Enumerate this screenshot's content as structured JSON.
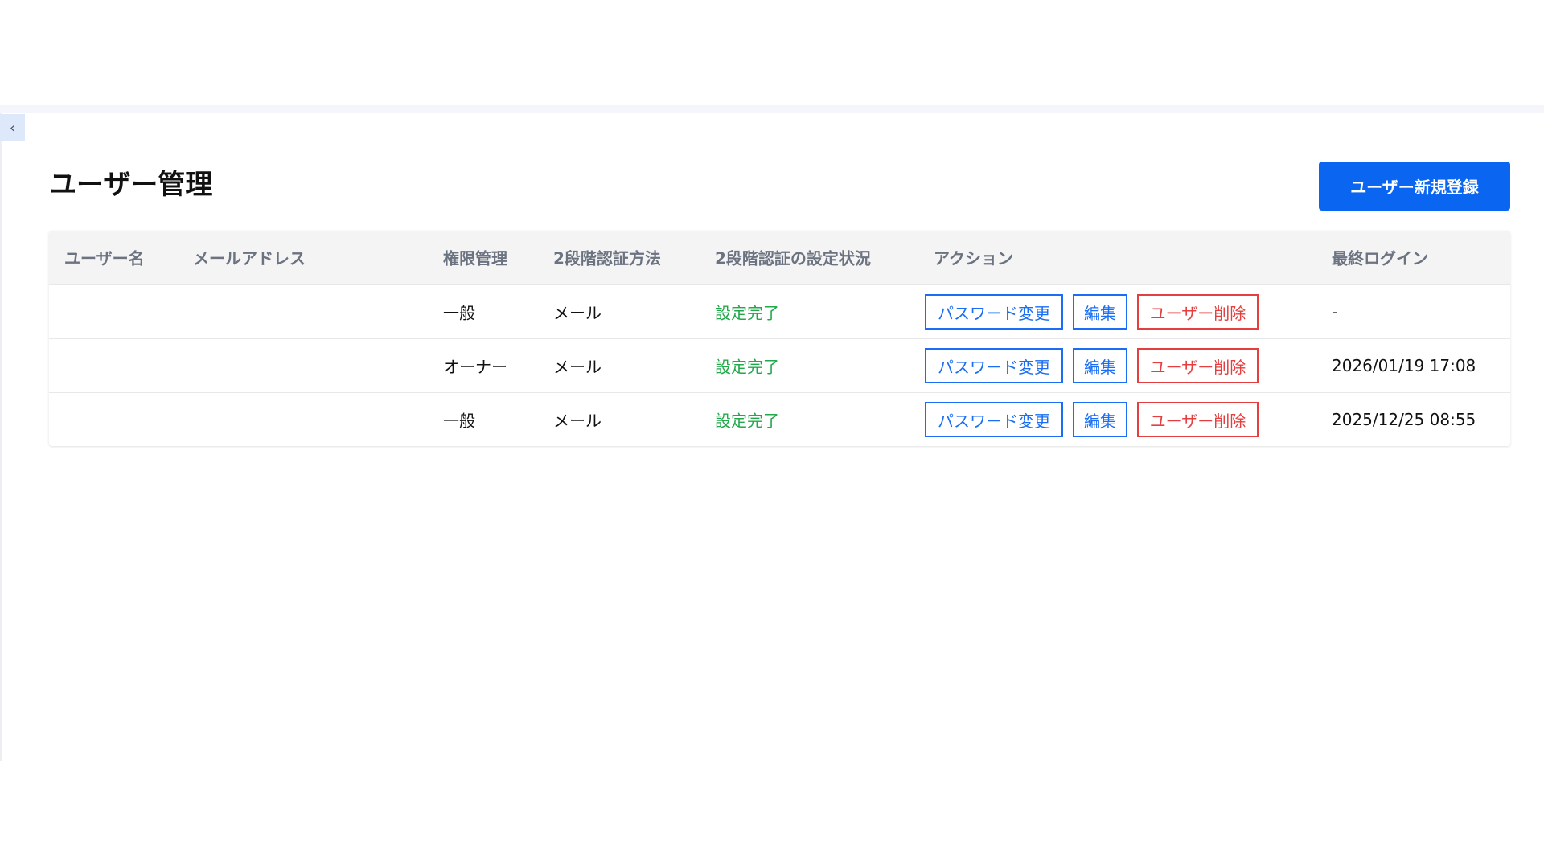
{
  "page": {
    "title": "ユーザー管理",
    "new_user_label": "ユーザー新規登録",
    "collapse_icon": "chevron-left-icon"
  },
  "table": {
    "headers": [
      "ユーザー名",
      "メールアドレス",
      "権限管理",
      "2段階認証方法",
      "2段階認証の設定状況",
      "アクション",
      "最終ログイン"
    ],
    "actions": {
      "password": "パスワード変更",
      "edit": "編集",
      "delete": "ユーザー削除"
    },
    "rows": [
      {
        "username": "",
        "email": "",
        "role": "一般",
        "method": "メール",
        "status": "設定完了",
        "last_login": "-"
      },
      {
        "username": "",
        "email": "",
        "role": "オーナー",
        "method": "メール",
        "status": "設定完了",
        "last_login": "2026/01/19 17:08"
      },
      {
        "username": "",
        "email": "",
        "role": "一般",
        "method": "メール",
        "status": "設定完了",
        "last_login": "2025/12/25 08:55"
      }
    ]
  },
  "colors": {
    "primary": "#0a66f0",
    "danger": "#e53e3e",
    "success": "#22a84a"
  }
}
